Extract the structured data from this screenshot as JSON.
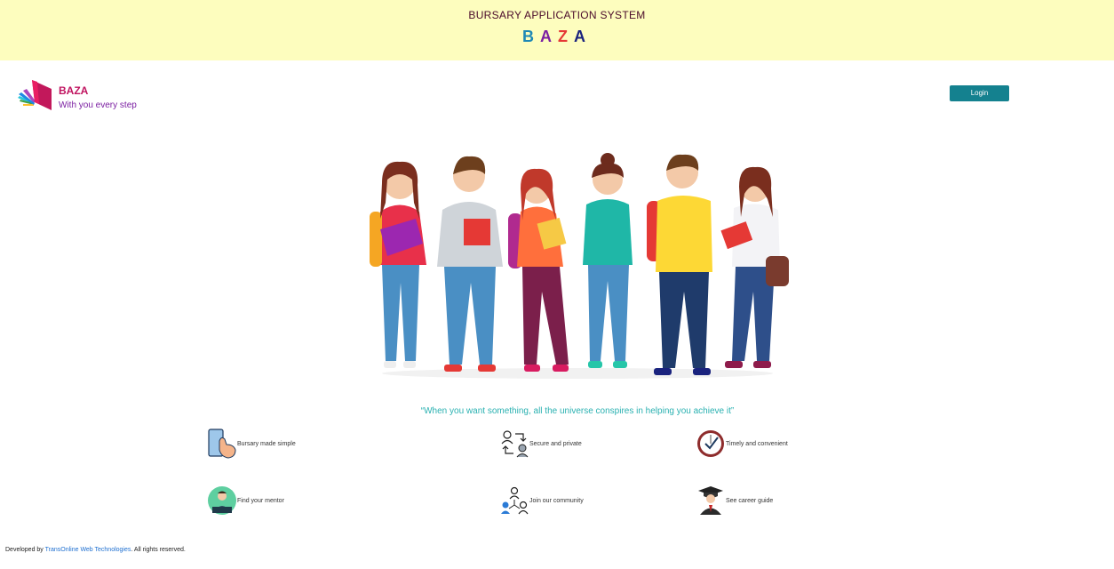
{
  "banner": {
    "system_title": "BURSARY APPLICATION SYSTEM",
    "baza_letters": [
      {
        "char": "B",
        "color": "#1e88b5"
      },
      {
        "char": "A",
        "color": "#7b1fa2"
      },
      {
        "char": "Z",
        "color": "#e53935"
      },
      {
        "char": "A",
        "color": "#1a237e"
      }
    ]
  },
  "header": {
    "brand": "BAZA",
    "tagline": "With you every step",
    "login_label": "Login"
  },
  "hero": {
    "icon": "students-group-illustration"
  },
  "quote": "“When you want something, all the universe conspires in helping you achieve it”",
  "features": [
    {
      "label": "Bursary made simple",
      "icon": "phone-tap-icon"
    },
    {
      "label": "Secure and private",
      "icon": "user-exchange-icon"
    },
    {
      "label": "Timely and convenient",
      "icon": "clock-check-icon"
    },
    {
      "label": "Find your mentor",
      "icon": "mentor-icon"
    },
    {
      "label": "Join our community",
      "icon": "community-icon"
    },
    {
      "label": "See career guide",
      "icon": "graduate-icon"
    }
  ],
  "footer": {
    "prefix": "Developed by ",
    "company": "TransOnline Web Technologies",
    "suffix": ". All rights reserved."
  },
  "colors": {
    "banner_bg": "#fdfdbe",
    "login_bg": "#14818f",
    "quote": "#2ab1b1",
    "brand": "#c0135f",
    "tagline": "#7b1fa2"
  }
}
